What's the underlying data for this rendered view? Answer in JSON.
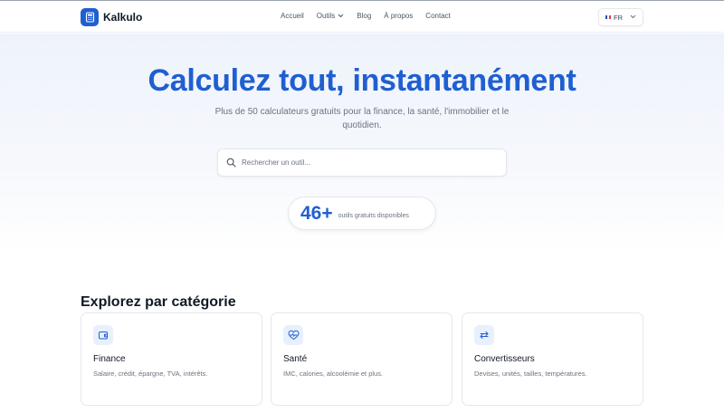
{
  "header": {
    "brand": "Kalkulo",
    "nav": [
      {
        "label": "Accueil"
      },
      {
        "label": "Outils",
        "has_dropdown": true
      },
      {
        "label": "Blog"
      },
      {
        "label": "À propos"
      },
      {
        "label": "Contact"
      }
    ],
    "language": "FR"
  },
  "hero": {
    "title": "Calculez tout, instantanément",
    "subtitle": "Plus de 50 calculateurs gratuits pour la finance, la santé, l'immobilier et le quotidien.",
    "search_placeholder": "Rechercher un outil...",
    "stat_value": "46+",
    "stat_label": "outils gratuits disponibles"
  },
  "categories": {
    "title": "Explorez par catégorie",
    "items": [
      {
        "title": "Finance",
        "description": "Salaire, crédit, épargne, TVA, intérêts.",
        "icon": "wallet-icon"
      },
      {
        "title": "Santé",
        "description": "IMC, calories, alcoolémie et plus.",
        "icon": "heart-pulse-icon"
      },
      {
        "title": "Convertisseurs",
        "description": "Devises, unités, tailles, températures.",
        "icon": "swap-arrows-icon"
      }
    ]
  },
  "colors": {
    "accent": "#1f5fd1",
    "accent_light": "#e8f0fd",
    "text": "#111827",
    "muted": "#6b7280"
  }
}
